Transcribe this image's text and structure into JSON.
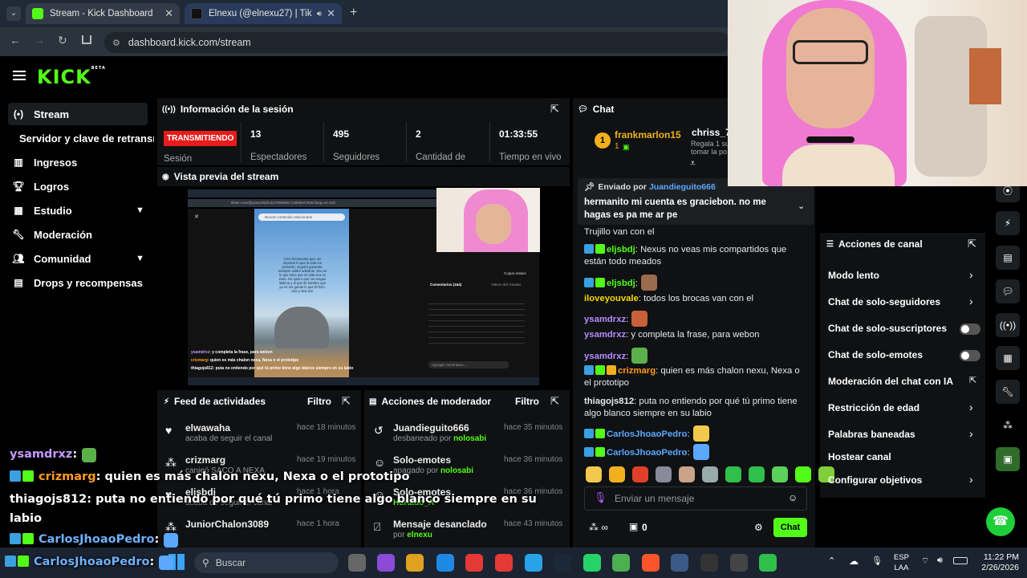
{
  "browser": {
    "tabs": [
      {
        "title": "Stream - Kick Dashboard"
      },
      {
        "title": "Elnexu (@elnexu27) | TikTok"
      }
    ],
    "url": "dashboard.kick.com/stream"
  },
  "kick": {
    "logo": "KICK",
    "logo_sup": "BETA"
  },
  "sidebar": {
    "items": [
      {
        "label": "Stream",
        "icon": "radio-icon"
      },
      {
        "label": "Servidor y clave de retransmisión"
      },
      {
        "label": "Ingresos",
        "icon": "chart-icon"
      },
      {
        "label": "Logros",
        "icon": "trophy-icon"
      },
      {
        "label": "Estudio",
        "icon": "grid-icon"
      },
      {
        "label": "Moderación",
        "icon": "wrench-icon"
      },
      {
        "label": "Comunidad",
        "icon": "users-icon"
      },
      {
        "label": "Drops y recompensas",
        "icon": "gift-icon"
      }
    ]
  },
  "session": {
    "title": "Información de la sesión",
    "live_label": "TRANSMITIENDO",
    "live_caption": "Sesión",
    "stats": [
      {
        "value": "13",
        "label": "Espectadores"
      },
      {
        "value": "495",
        "label": "Seguidores"
      },
      {
        "value": "2",
        "label": "Cantidad de"
      },
      {
        "value": "01:33:55",
        "label": "Tiempo en vivo"
      }
    ]
  },
  "preview": {
    "title": "Vista previa del stream",
    "inner_url": "tiktok.com/@gsamdr/photo/7609085712806847506?lang=es-419",
    "inner_search": "Buscar contenido relacionado",
    "inner_caption": "Creo firmemente que, sin importar lo que la vida me presente, seguiré ganando. Siempre saldré adelante. Eso es lo que hace que mi vida sea un éxito. No quiero que me tengan lástima y di que de hambre que ya no me ganan lo que Él hizo. Una y otra vez.",
    "inner_comments_tab": "Comentarios (164)",
    "inner_videos_tab": "Videos del creador",
    "inner_add_comment": "Agregar comentario...",
    "inner_copy": "Copiar enlace",
    "inner_chat": [
      {
        "user": "ysamdrxz",
        "text": ": y completa la frase, para webon"
      },
      {
        "user": "crizmarg",
        "text": ": quien es más chalon nexu, Nexa o el prototipo"
      },
      {
        "user": "thiagojs812",
        "text": ": puta no entiendo por qué tú primo tiene algo blanco siempre en su labio"
      }
    ]
  },
  "activity": {
    "title": "Feed de actividades",
    "filter": "Filtro",
    "items": [
      {
        "name": "elwawaha",
        "time": "hace 18 minutos",
        "sub": "acaba de seguir el canal",
        "icon": "heart-icon"
      },
      {
        "name": "crizmarg",
        "time": "hace 19 minutos",
        "sub": "canjeó SACO A NEXA",
        "icon": "gift-icon"
      },
      {
        "name": "eljsbdj",
        "time": "hace 1 hora",
        "sub": "acaba de seguir el canal",
        "icon": "heart-icon"
      },
      {
        "name": "JuniorChalon3089",
        "time": "hace 1 hora",
        "sub": "",
        "icon": "gift-icon"
      }
    ]
  },
  "modactions": {
    "title": "Acciones de moderador",
    "filter": "Filtro",
    "items": [
      {
        "name": "Juandieguito666",
        "time": "hace 35 minutos",
        "sub": "desbaneado por ",
        "by": "nolosabi",
        "icon": "undo-icon"
      },
      {
        "name": "Solo-emotes",
        "time": "hace 36 minutos",
        "sub": "apagado por ",
        "by": "nolosabi",
        "icon": "emote-icon"
      },
      {
        "name": "Solo-emotes",
        "time": "hace 36 minutos",
        "sub": "",
        "by": "Hurtado_A",
        "icon": "emote-icon"
      },
      {
        "name": "Mensaje desanclado",
        "time": "hace 43 minutos",
        "sub": "por ",
        "by": "elnexu",
        "icon": "unpin-icon"
      }
    ]
  },
  "chat": {
    "title": "Chat",
    "top_user": "frankmarlon15",
    "top_rank": "1",
    "top_count": "1",
    "top_user2": "chriss_7",
    "top_user2_sub1": "Regala 1 su",
    "top_user2_sub2": "tomar la po",
    "pinned_by_label": "Enviado por",
    "pinned_by": "Juandieguito666",
    "pinned_text": "hermanito mi cuenta es graciebon. no me hagas es pa me ar pe",
    "messages": [
      {
        "user": "",
        "text": "Trujillo van con el",
        "color": "#e8e8e8"
      },
      {
        "user": "eljsbdj",
        "text": ": Nexus no veas mis compartidos que están todo meados",
        "color": "#53fc18"
      },
      {
        "user": "eljsbdj",
        "text": ":",
        "color": "#53fc18"
      },
      {
        "user": "iloveyouvale",
        "text": ": todos los brocas van con el",
        "color": "#f5d800"
      },
      {
        "user": "ysamdrxz",
        "text": ":",
        "color": "#b58cff"
      },
      {
        "user": "ysamdrxz",
        "text": ": y completa la frase, para webon",
        "color": "#b58cff"
      },
      {
        "user": "ysamdrxz",
        "text": ":",
        "color": "#b58cff"
      },
      {
        "user": "crizmarg",
        "text": ": quien es más chalon nexu, Nexa o el prototipo",
        "color": "#ff9a1f"
      },
      {
        "user": "thiagojs812",
        "text": ": puta no entiendo por qué tú primo tiene algo blanco siempre en su labio",
        "color": "#e8e8e8"
      },
      {
        "user": "CarlosJhoaoPedro",
        "text": ":",
        "color": "#5aa8ff"
      },
      {
        "user": "CarlosJhoaoPedro",
        "text": ":",
        "color": "#5aa8ff"
      }
    ],
    "input_placeholder": "Enviar un mensaje",
    "viewers_icon_text": "∞",
    "count": "0",
    "send_label": "Chat"
  },
  "channel_actions": {
    "title": "Acciones de canal",
    "items": [
      {
        "label": "Modo lento",
        "kind": "chevron"
      },
      {
        "label": "Chat de solo-seguidores",
        "kind": "chevron"
      },
      {
        "label": "Chat de solo-suscriptores",
        "kind": "toggle"
      },
      {
        "label": "Chat de solo-emotes",
        "kind": "toggle"
      },
      {
        "label": "Moderación del chat con IA",
        "kind": "external"
      },
      {
        "label": "Restricción de edad",
        "kind": "chevron"
      },
      {
        "label": "Palabras baneadas",
        "kind": "chevron"
      },
      {
        "label": "Hostear canal",
        "kind": "none"
      },
      {
        "label": "Configurar objetivos",
        "kind": "chevron"
      }
    ]
  },
  "overlay_chat": [
    {
      "user": "ysamdrxz",
      "text": ":",
      "color": "#c59bff"
    },
    {
      "user": "crizmarg",
      "text": ": quien es más chalon nexu, Nexa o el prototipo",
      "color": "#ff9a1f"
    },
    {
      "user": "thiagojs812",
      "text": ": puta no entiendo por qué tú primo tiene algo blanco siempre en su",
      "color": "#ffffff"
    },
    {
      "user": "",
      "text": "labio",
      "color": "#ffffff"
    },
    {
      "user": "CarlosJhoaoPedro",
      "text": ":",
      "color": "#6fb1ff"
    },
    {
      "user": "CarlosJhoaoPedro",
      "text": ":",
      "color": "#6fb1ff"
    }
  ],
  "taskbar": {
    "search_placeholder": "Buscar",
    "lang1": "ESP",
    "lang2": "LAA",
    "time": "11:22 PM",
    "date": "2/26/2026"
  },
  "colors": {
    "accent": "#53fc18",
    "live": "#e81c1c",
    "panel": "#0f1113"
  }
}
